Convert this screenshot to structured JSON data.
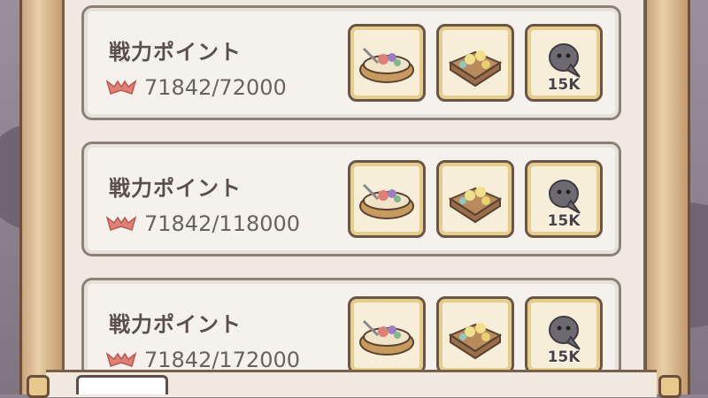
{
  "cards": [
    {
      "title": "戦力ポイント",
      "progress": "71842/72000",
      "progress_fraction": 0.9978,
      "rewards": [
        {
          "icon": "food-bowl-icon",
          "qty": ""
        },
        {
          "icon": "gem-box-icon",
          "qty": ""
        },
        {
          "icon": "ghost-spirit-icon",
          "qty": "15K"
        }
      ]
    },
    {
      "title": "戦力ポイント",
      "progress": "71842/118000",
      "progress_fraction": 0.6088,
      "rewards": [
        {
          "icon": "food-bowl-icon",
          "qty": ""
        },
        {
          "icon": "gem-box-icon",
          "qty": ""
        },
        {
          "icon": "ghost-spirit-icon",
          "qty": "15K"
        }
      ]
    },
    {
      "title": "戦力ポイント",
      "progress": "71842/172000",
      "progress_fraction": 0.4177,
      "rewards": [
        {
          "icon": "food-bowl-icon",
          "qty": ""
        },
        {
          "icon": "gem-box-icon",
          "qty": ""
        },
        {
          "icon": "ghost-spirit-icon",
          "qty": "15K"
        }
      ]
    }
  ],
  "colors": {
    "card_bg": "#f5f2ee",
    "slot_border": "#6b5544",
    "slot_inner": "#e6cd8a",
    "bat_icon": "#e07f73"
  }
}
